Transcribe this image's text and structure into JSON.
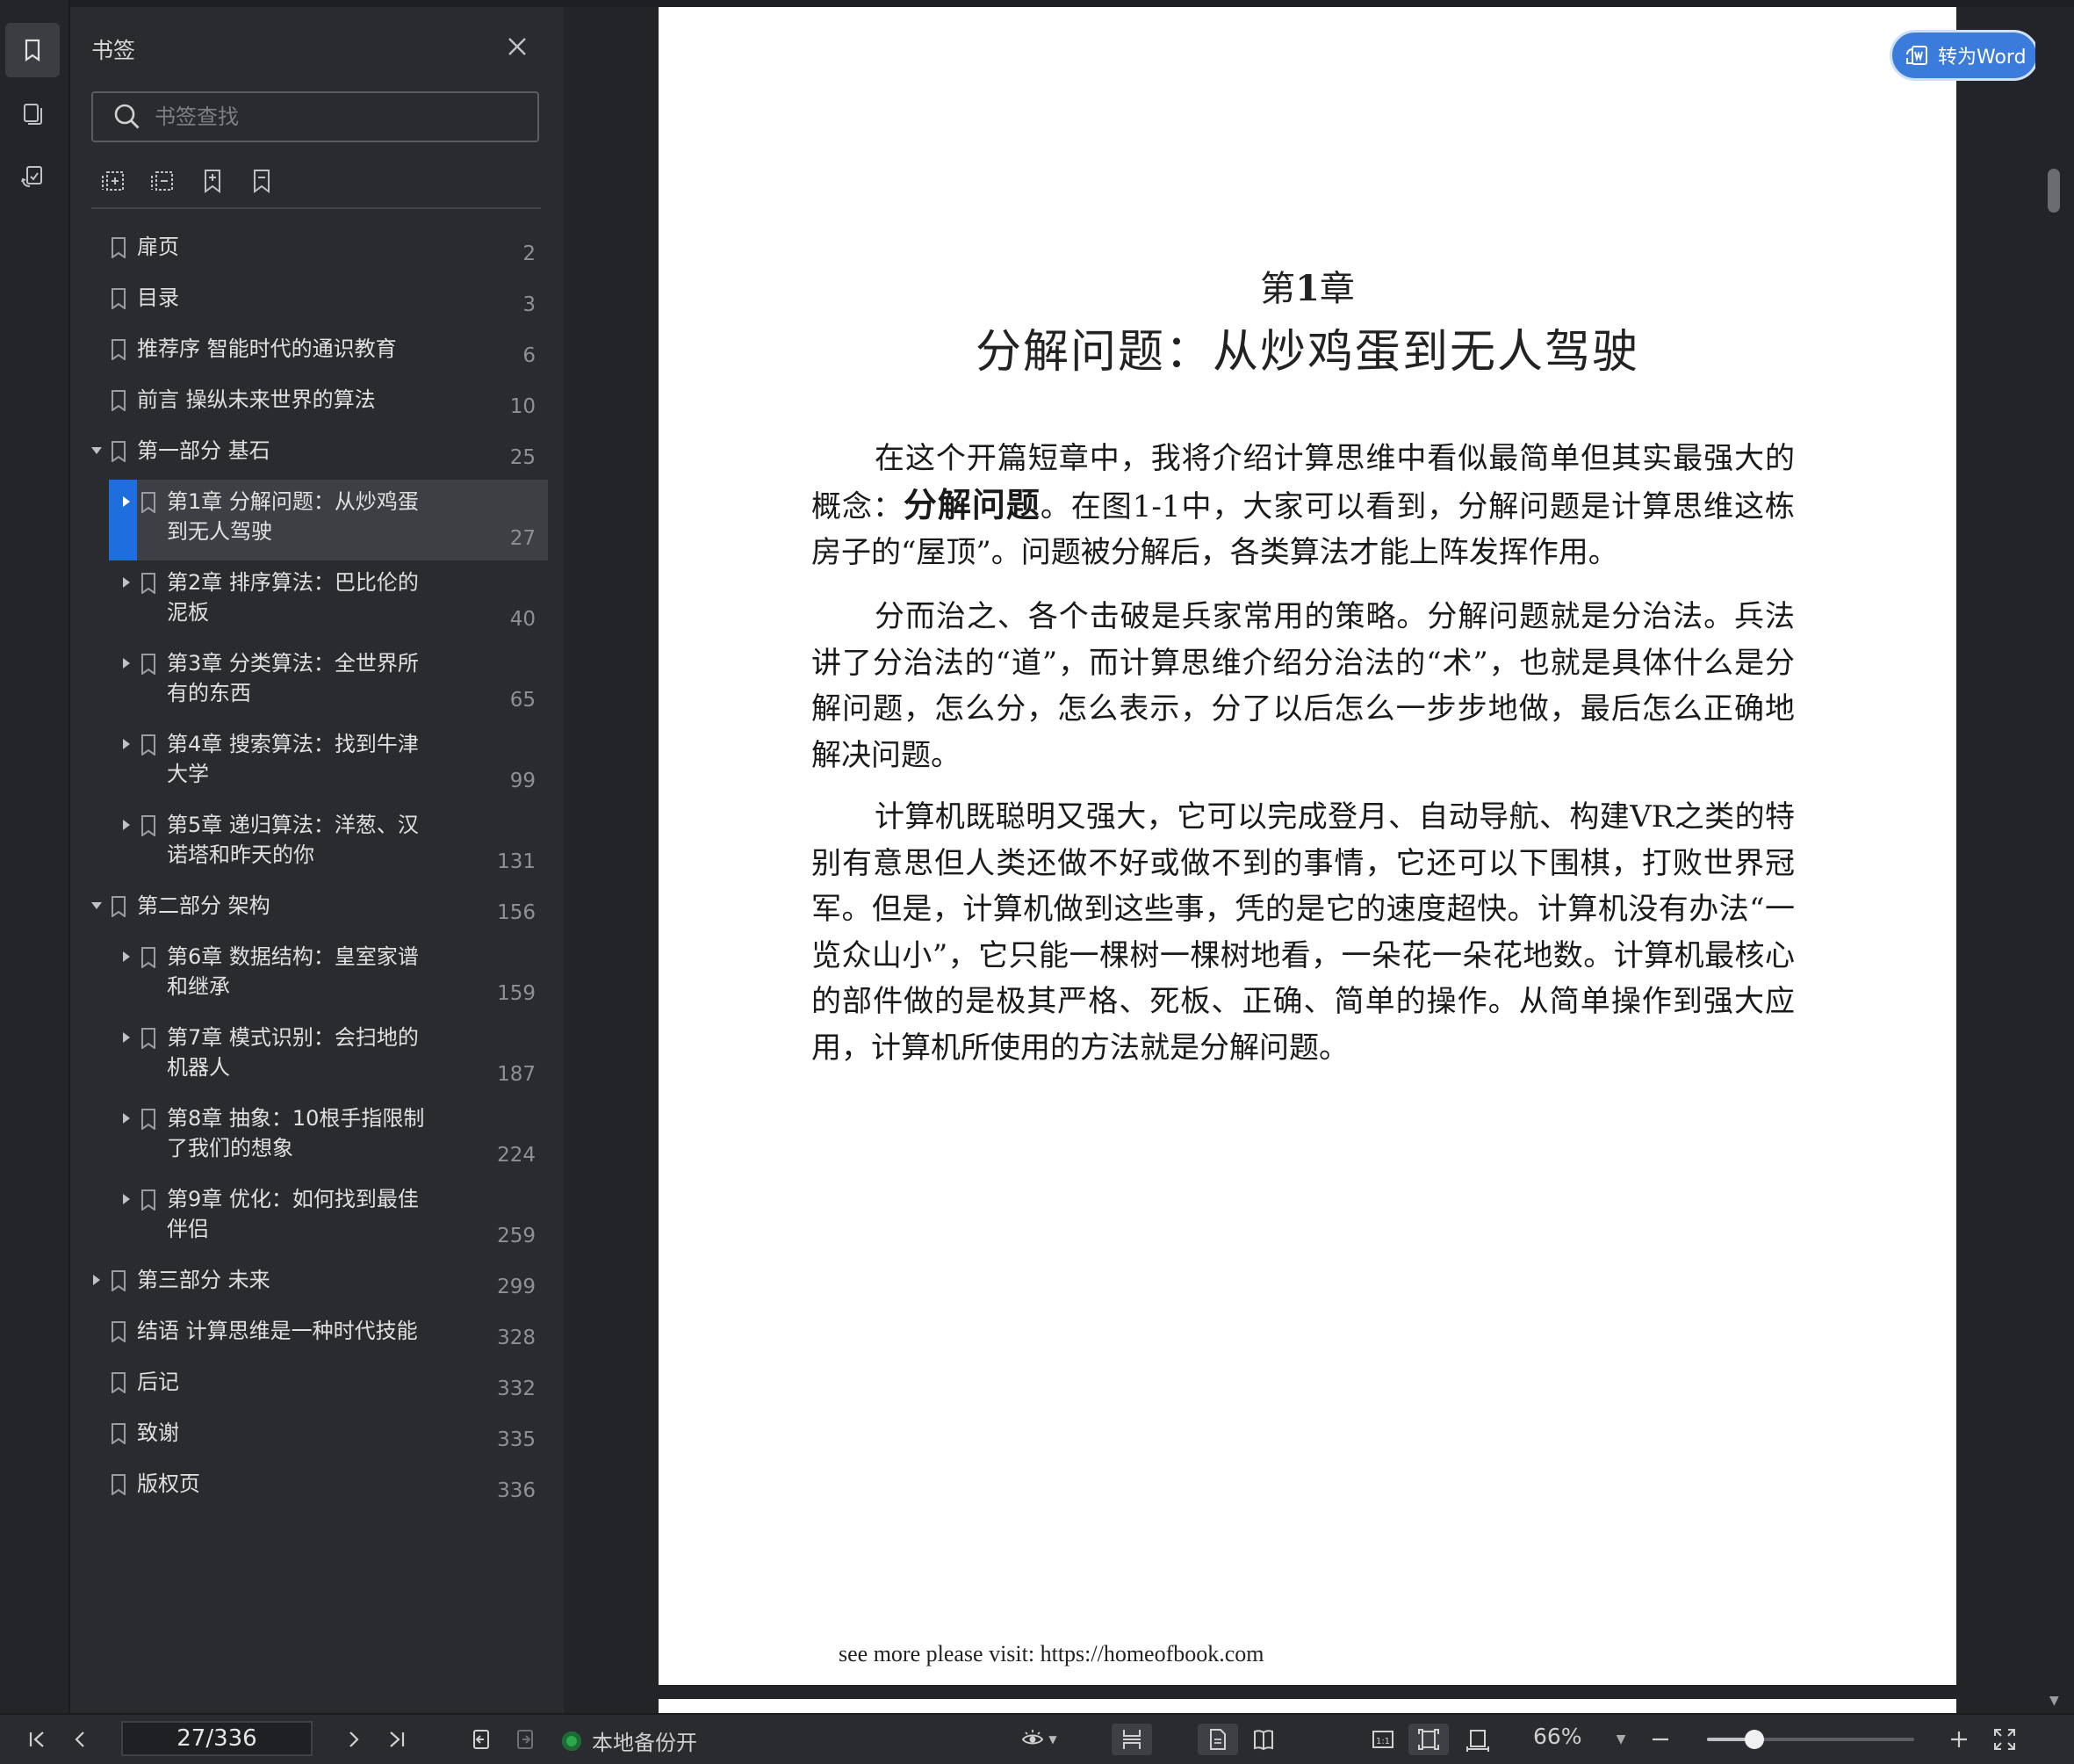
{
  "panel": {
    "title": "书签",
    "search_placeholder": "书签查找"
  },
  "bookmarks": [
    {
      "label": "扉页",
      "page": "2"
    },
    {
      "label": "目录",
      "page": "3"
    },
    {
      "label": "推荐序 智能时代的通识教育",
      "page": "6"
    },
    {
      "label": "前言 操纵未来世界的算法",
      "page": "10"
    },
    {
      "label": "第一部分 基石",
      "page": "25",
      "expanded": true
    },
    {
      "label": "第1章 分解问题：从炒鸡蛋",
      "label2": "到无人驾驶",
      "page": "27",
      "selected": true
    },
    {
      "label": "第2章 排序算法：巴比伦的",
      "label2": "泥板",
      "page": "40"
    },
    {
      "label": "第3章 分类算法：全世界所",
      "label2": "有的东西",
      "page": "65"
    },
    {
      "label": "第4章 搜索算法：找到牛津",
      "label2": "大学",
      "page": "99"
    },
    {
      "label": "第5章 递归算法：洋葱、汉",
      "label2": "诺塔和昨天的你",
      "page": "131"
    },
    {
      "label": "第二部分 架构",
      "page": "156",
      "expanded": true
    },
    {
      "label": "第6章 数据结构：皇室家谱",
      "label2": "和继承",
      "page": "159"
    },
    {
      "label": "第7章 模式识别：会扫地的",
      "label2": "机器人",
      "page": "187"
    },
    {
      "label": "第8章 抽象：10根手指限制",
      "label2": "了我们的想象",
      "page": "224"
    },
    {
      "label": "第9章 优化：如何找到最佳",
      "label2": "伴侣",
      "page": "259"
    },
    {
      "label": "第三部分 未来",
      "page": "299",
      "expanded": false
    },
    {
      "label": "结语 计算思维是一种时代技能",
      "page": "328"
    },
    {
      "label": "后记",
      "page": "332"
    },
    {
      "label": "致谢",
      "page": "335"
    },
    {
      "label": "版权页",
      "page": "336"
    }
  ],
  "document": {
    "chapter_prefix": "第",
    "chapter_num": "1",
    "chapter_suffix": "章",
    "chapter_title": "分解问题：从炒鸡蛋到无人驾驶",
    "p1_a": "在这个开篇短章中，我将介绍计算思维中看似最简单但其实最强大的概念：",
    "p1_bold": "分解问题",
    "p1_b": "。在图1-1中，大家可以看到，分解问题是计算思维这栋房子的“屋顶”。问题被分解后，各类算法才能上阵发挥作用。",
    "p2": "分而治之、各个击破是兵家常用的策略。分解问题就是分治法。兵法讲了分治法的“道”，而计算思维介绍分治法的“术”，也就是具体什么是分解问题，怎么分，怎么表示，分了以后怎么一步步地做，最后怎么正确地解决问题。",
    "p3": "计算机既聪明又强大，它可以完成登月、自动导航、构建VR之类的特别有意思但人类还做不好或做不到的事情，它还可以下围棋，打败世界冠军。但是，计算机做到这些事，凭的是它的速度超快。计算机没有办法“一览众山小”，它只能一棵树一棵树地看，一朵花一朵花地数。计算机最核心的部件做的是极其严格、死板、正确、简单的操作。从简单操作到强大应用，计算机所使用的方法就是分解问题。",
    "footer_note": "see more please visit: https://homeofbook.com",
    "to_word_label": "转为Word"
  },
  "statusbar": {
    "page_indicator": "27/336",
    "backup_status": "本地备份开",
    "zoom": "66%",
    "zoom_fraction": 0.23
  },
  "colors": {
    "accent": "#1e6ee0",
    "to_word": "#3a7bdc",
    "backup_dot": "#2ca84e"
  }
}
